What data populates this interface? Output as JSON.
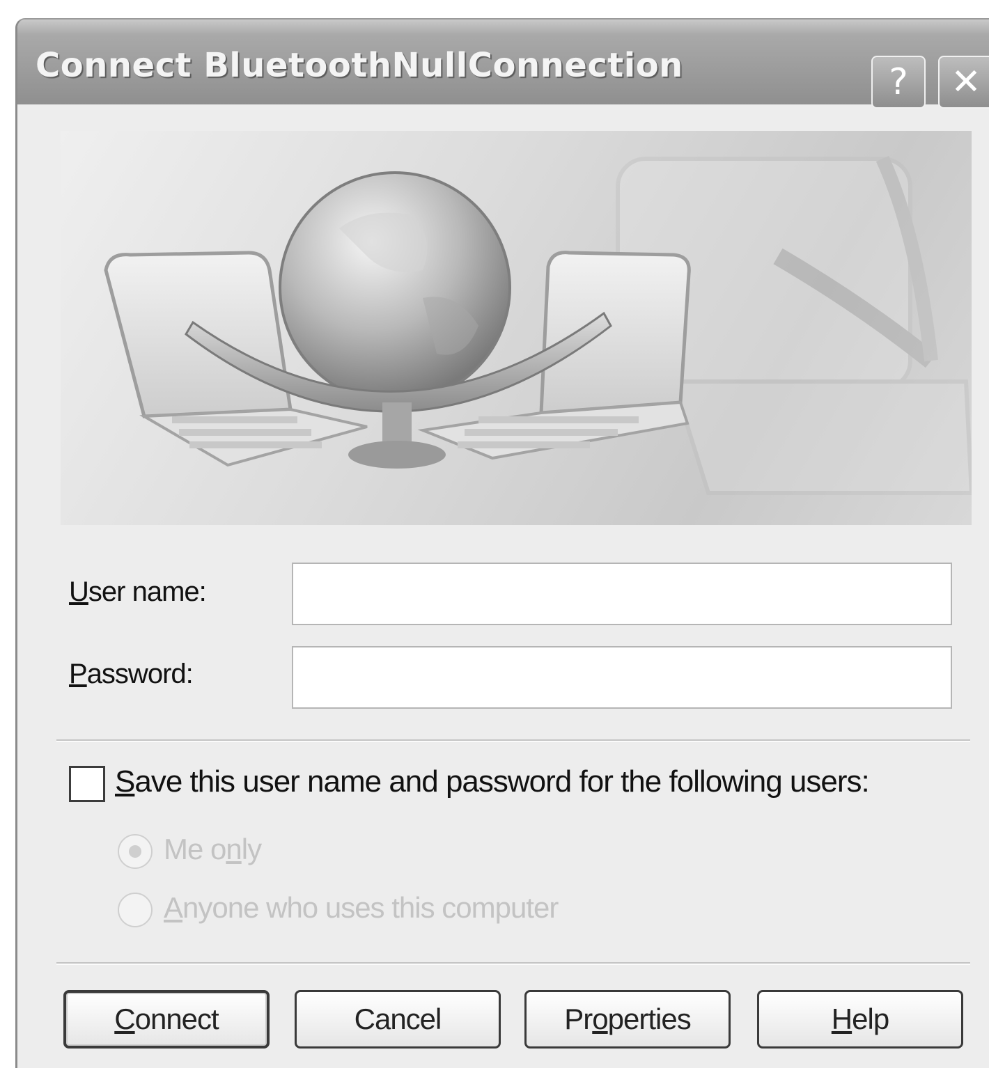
{
  "window": {
    "title": "Connect BluetoothNullConnection",
    "help_button": "?",
    "close_button": "✕"
  },
  "banner": {
    "image": "network-connection-globe-laptops"
  },
  "form": {
    "username_label_accel": "U",
    "username_label_rest": "ser name:",
    "username_value": "",
    "password_label_accel": "P",
    "password_label_rest": "assword:",
    "password_value": ""
  },
  "save": {
    "checked": false,
    "label_accel": "S",
    "label_rest": "ave this user name and password for the following users:",
    "options": [
      {
        "label_pre": "Me o",
        "label_accel": "n",
        "label_post": "ly",
        "selected": true,
        "enabled": false
      },
      {
        "label_pre": "",
        "label_accel": "A",
        "label_post": "nyone who uses this computer",
        "selected": false,
        "enabled": false
      }
    ]
  },
  "buttons": {
    "connect_accel": "C",
    "connect_rest": "onnect",
    "cancel": "Cancel",
    "properties_pre": "Pr",
    "properties_accel": "o",
    "properties_post": "perties",
    "help_accel": "H",
    "help_rest": "elp"
  },
  "colors": {
    "titlebar": "#9c9c9c",
    "dialog_bg": "#ededed",
    "disabled_text": "#c3c3c3"
  }
}
